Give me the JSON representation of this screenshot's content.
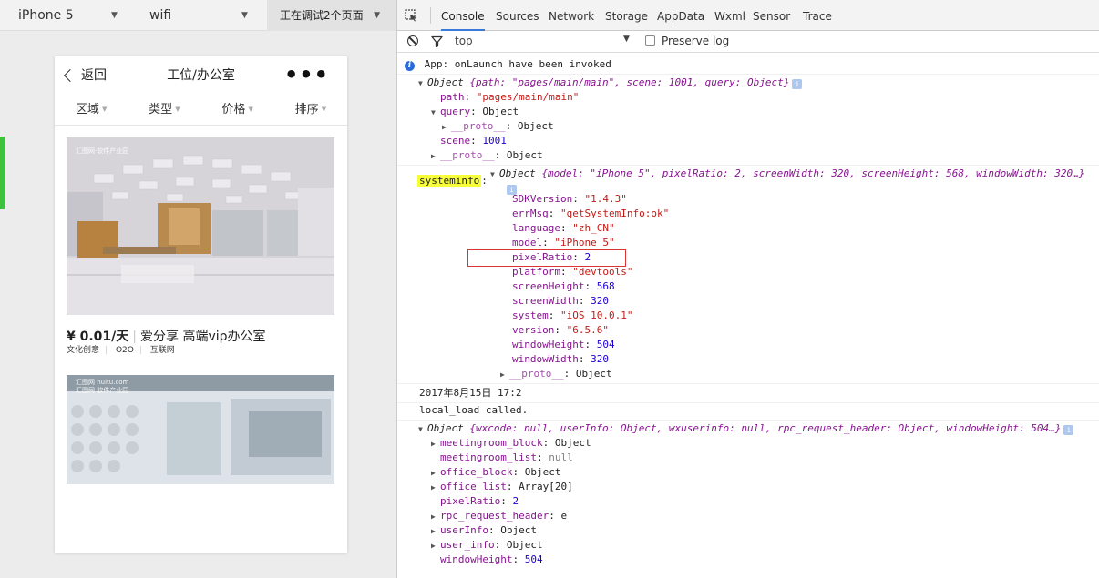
{
  "simulator": {
    "device": "iPhone 5",
    "network": "wifi",
    "debug_status": "正在调试2个页面",
    "phone": {
      "back_label": "返回",
      "title": "工位/办公室",
      "more_label": "•••",
      "filters": [
        "区域",
        "类型",
        "价格",
        "排序"
      ],
      "listing": {
        "price": "¥ 0.01/天",
        "name": "爱分享 高端vip办公室",
        "tags": [
          "文化创意",
          "O2O",
          "互联网"
        ],
        "watermark": "汇图网·软件产业园",
        "watermark2": "汇图网 huitu.com",
        "watermark3": "汇图网·软件产业园"
      }
    }
  },
  "devtools": {
    "tabs": [
      "Console",
      "Sources",
      "Network",
      "Storage",
      "AppData",
      "Wxml",
      "Sensor",
      "Trace"
    ],
    "active_tab": "Console",
    "context": "top",
    "preserve_log_label": "Preserve log",
    "console": {
      "info_line": "App: onLaunch have been invoked",
      "obj1_summary_prefix": "Object ",
      "obj1_summary": "{path: \"pages/main/main\", scene: 1001, query: Object}",
      "obj1_path_key": "path",
      "obj1_path_val": "\"pages/main/main\"",
      "obj1_query_key": "query",
      "obj1_query_val": "Object",
      "proto_key": "__proto__",
      "proto_val": "Object",
      "obj1_scene_key": "scene",
      "obj1_scene_val": "1001",
      "systeminfo_label": "systeminfo",
      "sys_summary": "{model: \"iPhone 5\", pixelRatio: 2, screenWidth: 320, screenHeight: 568, windowWidth: 320…}",
      "sys_props": [
        {
          "key": "SDKVersion",
          "val": "\"1.4.3\"",
          "type": "string"
        },
        {
          "key": "errMsg",
          "val": "\"getSystemInfo:ok\"",
          "type": "string"
        },
        {
          "key": "language",
          "val": "\"zh_CN\"",
          "type": "string"
        },
        {
          "key": "model",
          "val": "\"iPhone 5\"",
          "type": "string"
        },
        {
          "key": "pixelRatio",
          "val": "2",
          "type": "number"
        },
        {
          "key": "platform",
          "val": "\"devtools\"",
          "type": "string"
        },
        {
          "key": "screenHeight",
          "val": "568",
          "type": "number"
        },
        {
          "key": "screenWidth",
          "val": "320",
          "type": "number"
        },
        {
          "key": "system",
          "val": "\"iOS 10.0.1\"",
          "type": "string"
        },
        {
          "key": "version",
          "val": "\"6.5.6\"",
          "type": "string"
        },
        {
          "key": "windowHeight",
          "val": "504",
          "type": "number"
        },
        {
          "key": "windowWidth",
          "val": "320",
          "type": "number"
        }
      ],
      "date_line": "2017年8月15日 17:2",
      "local_load": "local_load called.",
      "obj3_summary": "{wxcode: null, userInfo: Object, wxuserinfo: null, rpc_request_header: Object, windowHeight: 504…}",
      "obj3_props": [
        {
          "key": "meetingroom_block",
          "val": "Object",
          "expandable": true,
          "type": "plain"
        },
        {
          "key": "meetingroom_list",
          "val": "null",
          "expandable": false,
          "type": "null"
        },
        {
          "key": "office_block",
          "val": "Object",
          "expandable": true,
          "type": "plain"
        },
        {
          "key": "office_list",
          "val": "Array[20]",
          "expandable": true,
          "type": "plain"
        },
        {
          "key": "pixelRatio",
          "val": "2",
          "expandable": false,
          "type": "number"
        },
        {
          "key": "rpc_request_header",
          "val": "e",
          "expandable": true,
          "type": "plain"
        },
        {
          "key": "userInfo",
          "val": "Object",
          "expandable": true,
          "type": "plain"
        },
        {
          "key": "user_info",
          "val": "Object",
          "expandable": true,
          "type": "plain"
        },
        {
          "key": "windowHeight",
          "val": "504",
          "expandable": false,
          "type": "number"
        }
      ]
    }
  },
  "colors": {
    "accent_tab": "#3879d9",
    "highlight_yellow": "#f7ff38",
    "box_red": "#dd3333",
    "key_purple": "#881391",
    "string_red": "#c41a16",
    "number_blue": "#1c00cf",
    "sim_accent_green": "#3ec23e"
  }
}
